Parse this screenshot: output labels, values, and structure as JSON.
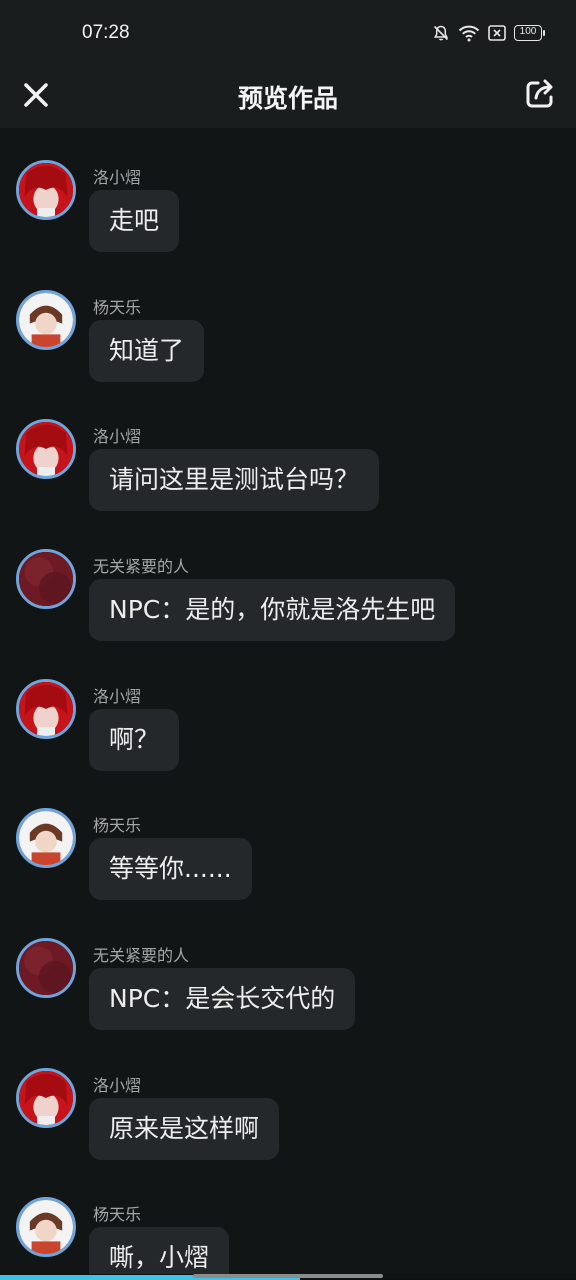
{
  "status_bar": {
    "time": "07:28",
    "battery": "100"
  },
  "header": {
    "title": "预览作品"
  },
  "messages": [
    {
      "sender": "洛小熠",
      "text": "走吧",
      "avatar": "red-hair-avatar"
    },
    {
      "sender": "杨天乐",
      "text": "知道了",
      "avatar": "brown-hair-avatar"
    },
    {
      "sender": "洛小熠",
      "text": "请问这里是测试台吗？",
      "avatar": "red-hair-avatar"
    },
    {
      "sender": "无关紧要的人",
      "text": "NPC：是的，你就是洛先生吧",
      "avatar": "npc-avatar"
    },
    {
      "sender": "洛小熠",
      "text": "啊？",
      "avatar": "red-hair-avatar"
    },
    {
      "sender": "杨天乐",
      "text": "等等你......",
      "avatar": "brown-hair-avatar"
    },
    {
      "sender": "无关紧要的人",
      "text": "NPC：是会长交代的",
      "avatar": "npc-avatar"
    },
    {
      "sender": "洛小熠",
      "text": "原来是这样啊",
      "avatar": "red-hair-avatar"
    },
    {
      "sender": "杨天乐",
      "text": "嘶，小熠",
      "avatar": "brown-hair-avatar"
    }
  ],
  "playback": {
    "progress": 0.52
  },
  "colors": {
    "accent": "#3ec2e6",
    "avatar_ring": "#6fa4dc",
    "bubble": "#24282a",
    "background": "#121516"
  }
}
